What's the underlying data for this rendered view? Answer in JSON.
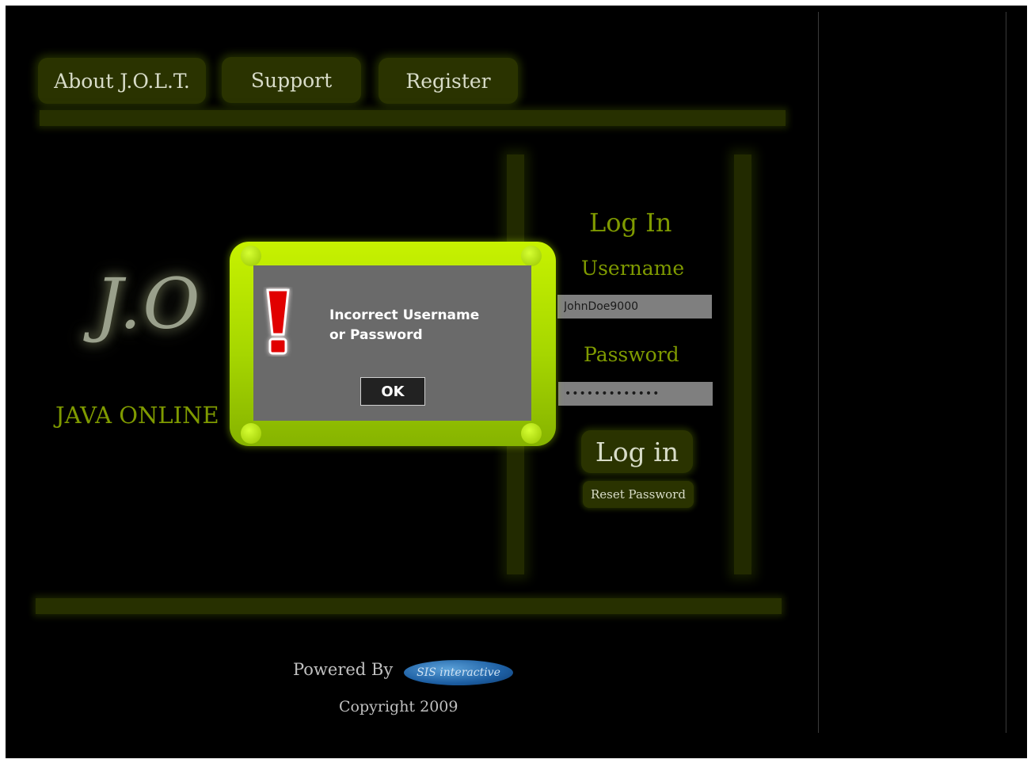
{
  "nav": {
    "about_label": "About J.O.L.T.",
    "support_label": "Support",
    "register_label": "Register"
  },
  "brand": {
    "logo_text": "J.O",
    "subtitle": "JAVA ONLINE"
  },
  "login": {
    "title": "Log In",
    "username_label": "Username",
    "username_value": "JohnDoe9000",
    "password_label": "Password",
    "password_value": "•••••••••••••",
    "login_button": "Log in",
    "reset_button": "Reset Password"
  },
  "footer": {
    "powered_by": "Powered By",
    "badge_text": "SIS interactive",
    "copyright": "Copyright 2009"
  },
  "dialog": {
    "icon": "exclamation-icon",
    "message_line1": "Incorrect Username",
    "message_line2": "or Password",
    "ok_label": "OK"
  },
  "colors": {
    "accent": "#7f9a00",
    "dialog_frame": "#a6d600",
    "background": "#000000"
  }
}
